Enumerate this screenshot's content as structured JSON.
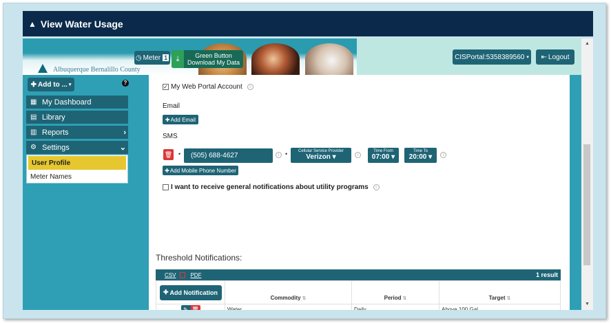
{
  "title": "View Water Usage",
  "header": {
    "logo_text": "Albuquerque Bernalillo County",
    "meter_label": "Meter",
    "meter_count": "1",
    "green_button_label_line1": "Green Button",
    "green_button_label_line2": "Download My Data",
    "portal_label": "CISPortal:5358389560",
    "logout_label": "Logout"
  },
  "sidebar": {
    "add_label": "Add to ...",
    "help": "?",
    "items": [
      {
        "label": "My Dashboard",
        "icon": "dashboard-icon"
      },
      {
        "label": "Library",
        "icon": "book-icon"
      },
      {
        "label": "Reports",
        "icon": "bar-chart-icon"
      },
      {
        "label": "Settings",
        "icon": "gear-icon"
      }
    ],
    "submenu": [
      {
        "label": "User Profile",
        "active": true
      },
      {
        "label": "Meter Names",
        "active": false
      }
    ]
  },
  "form": {
    "portal_account_label": "My Web Portal Account",
    "email_label": "Email",
    "add_email_label": "Add Email",
    "sms_label": "SMS",
    "phone_value": "(505) 688-4627",
    "provider_caption": "Cellular Service Provider",
    "provider_value": "Verizon",
    "time_from_caption": "Time From",
    "time_from_value": "07:00",
    "time_to_caption": "Time To",
    "time_to_value": "20:00",
    "add_phone_label": "Add Mobile Phone Number",
    "notifications_checkbox_label": "I want to receive general notifications about utility programs"
  },
  "threshold": {
    "title": "Threshold Notifications:",
    "csv_label": "CSV",
    "pdf_label": "PDF",
    "result_count": "1 result",
    "add_notification_label": "Add Notification",
    "columns": [
      "Commodity",
      "Period",
      "Target"
    ],
    "rows": [
      {
        "commodity": "Water",
        "period": "Daily",
        "target": "Above 100 Gal"
      }
    ]
  },
  "colors": {
    "titlebar": "#0b2a4b",
    "teal": "#2f9fb5",
    "dark_teal": "#1e6475",
    "active_yellow": "#e6c72f",
    "delete_red": "#d9383a"
  }
}
